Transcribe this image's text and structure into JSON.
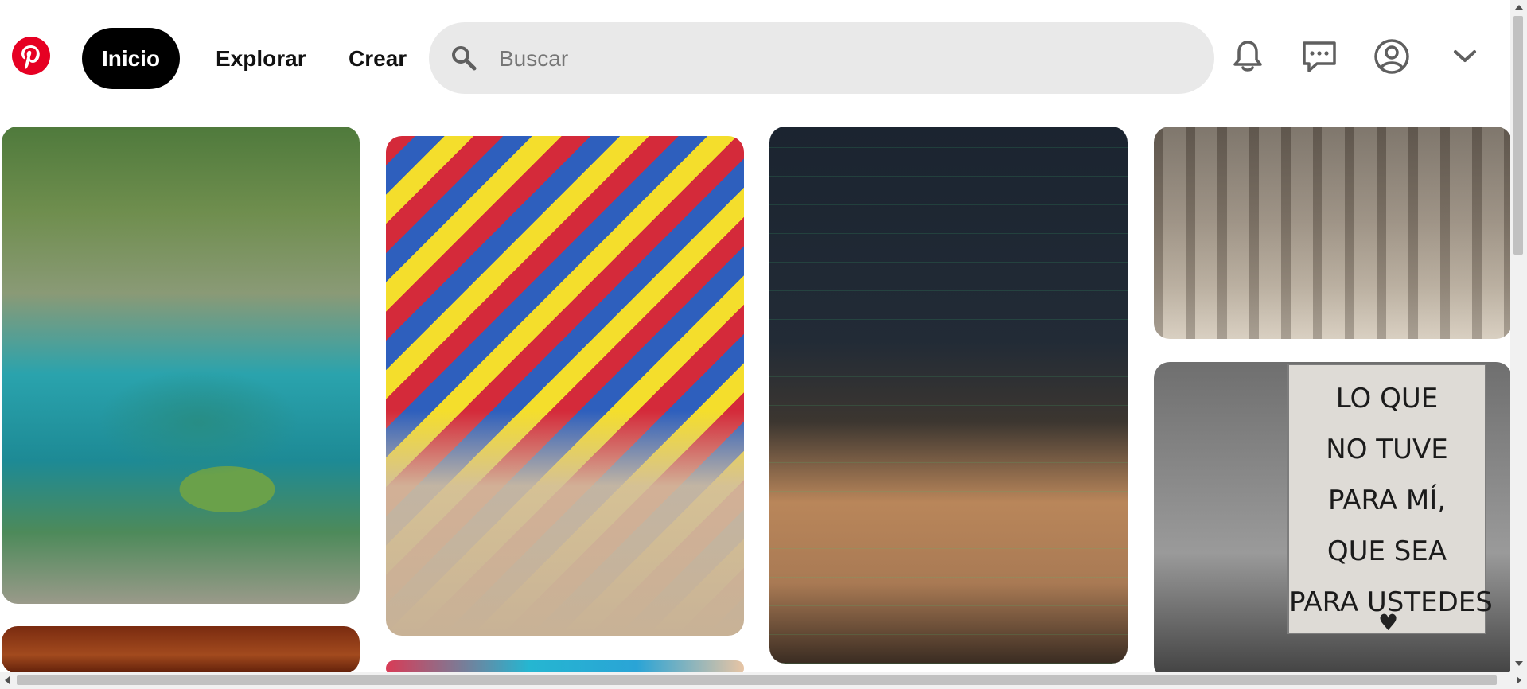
{
  "header": {
    "logo_icon": "pinterest-logo",
    "brand_color": "#e60023",
    "nav": {
      "home_label": "Inicio",
      "explore_label": "Explorar",
      "create_label": "Crear"
    },
    "search": {
      "placeholder": "Buscar",
      "value": ""
    },
    "icons": [
      "bell-icon",
      "chat-icon",
      "profile-icon",
      "chevron-down-icon"
    ]
  },
  "feed": {
    "pins": [
      {
        "column": 1,
        "subject": "turquoise pool with ivy-covered stone walls"
      },
      {
        "column": 1,
        "subject": "red rock texture"
      },
      {
        "column": 2,
        "subject": "colorful street with bunting flags and fruit cart"
      },
      {
        "column": 2,
        "subject": "colorful street"
      },
      {
        "column": 3,
        "subject": "trading charts on monitors and laptop desk"
      },
      {
        "column": 4,
        "subject": "vintage photograph of women workers"
      },
      {
        "column": 4,
        "subject": "protest sign"
      }
    ],
    "protest_sign_lines": [
      "LO QUE",
      "NO TUVE",
      "PARA MÍ,",
      "QUE SEA",
      "PARA USTEDES"
    ]
  }
}
